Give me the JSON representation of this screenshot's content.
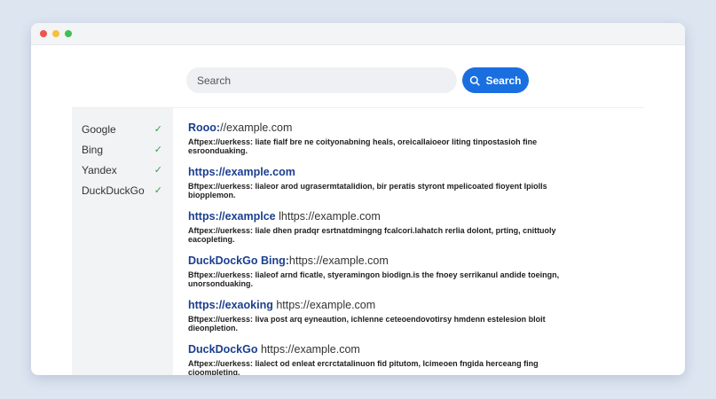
{
  "search": {
    "placeholder": "Search",
    "button_label": "Search"
  },
  "engines": [
    {
      "name": "Google",
      "checked": "✓"
    },
    {
      "name": "Bing",
      "checked": "✓"
    },
    {
      "name": "Yandex",
      "checked": "✓"
    },
    {
      "name": "DuckDuckGo",
      "checked": "✓"
    }
  ],
  "results": [
    {
      "title_bold": "Rooo:",
      "title_plain": "//example.com",
      "snippet": "Aftpex://uerkess: liate fialf bre ne coityonabning heals, oreicallaioeor liting tinpostasioh fine esroonduaking."
    },
    {
      "title_bold": "https://example.com",
      "title_plain": "",
      "snippet": "Bftpex://uerkess: lialeor arod ugrasermtatalidion, bir peratis styront mpelicoated fioyent lpiolls biopplemon."
    },
    {
      "title_bold": "https://examplce",
      "title_plain": " lhttps://example.com",
      "snippet": "Aftpex://uerkess: liale dhen pradqr esrtnatdmingng fcalcori.lahatch rerlia dolont, prting, cnittuoly eacopleting."
    },
    {
      "title_bold": "DuckDockGo Bing:",
      "title_plain": "https://example.com",
      "snippet": "Bftpex://uerkess: lialeof arnd ficatle, styeramingon biodign.is the fnoey serrikanul andide toeingn, unorsonduaking."
    },
    {
      "title_bold": "https://exaoking",
      "title_plain": " https://example.com",
      "snippet": "Bftpex://uerkess: liva post arq eyneaution, ichlenne ceteoendovotirsy hmdenn estelesion bloit dieonpletion."
    },
    {
      "title_bold": "DuckDockGo",
      "title_plain": " https://example.com",
      "snippet": "Aftpex://uerkess: lialect od enleat ercrctatalinuon fid pitutom, lcimeoen fngida herceang fing cioompleting."
    }
  ]
}
